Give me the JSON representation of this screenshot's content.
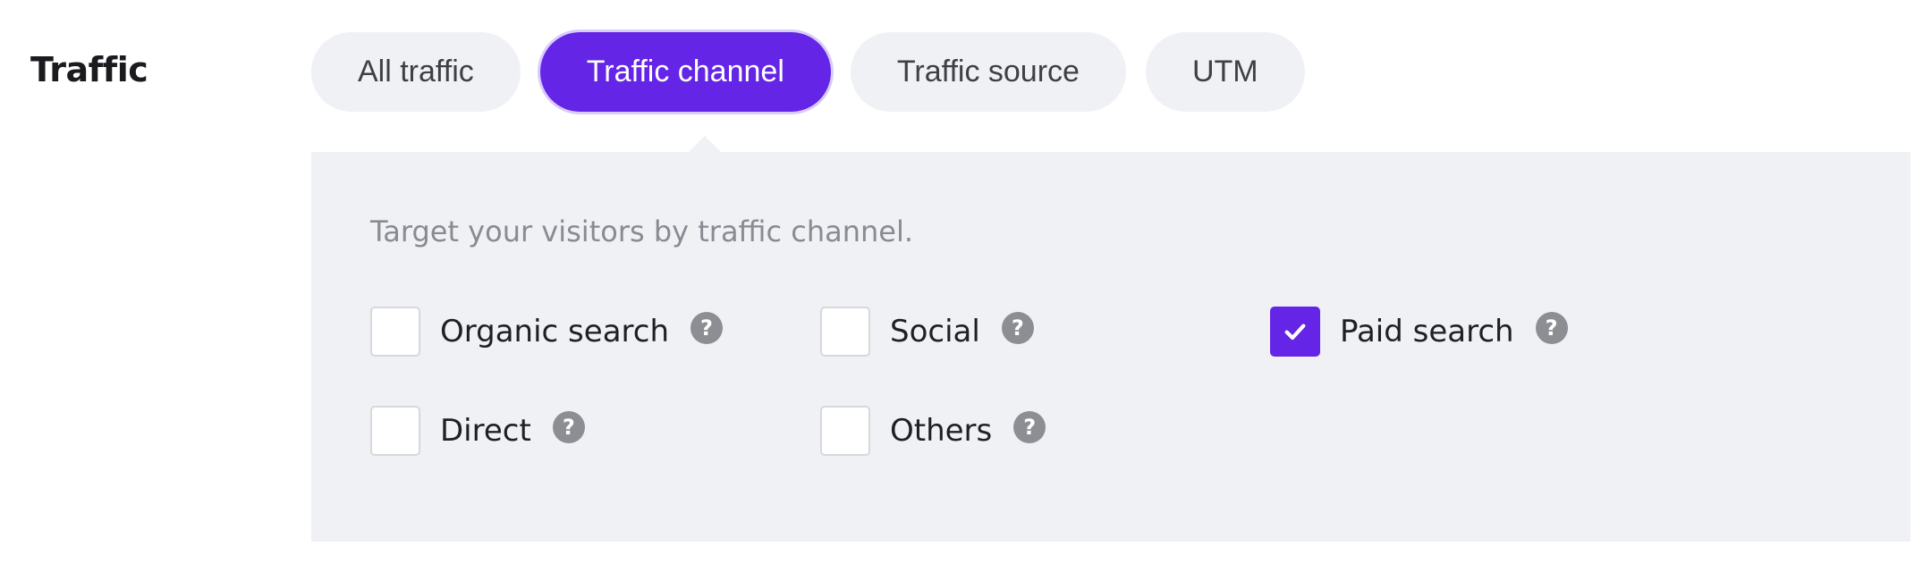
{
  "section": {
    "title": "Traffic"
  },
  "tabs": [
    {
      "label": "All traffic",
      "active": false
    },
    {
      "label": "Traffic channel",
      "active": true
    },
    {
      "label": "Traffic source",
      "active": false
    },
    {
      "label": "UTM",
      "active": false
    }
  ],
  "panel": {
    "description": "Target your visitors by traffic channel.",
    "options": [
      {
        "label": "Organic search",
        "checked": false,
        "help_icon": "question-mark-icon"
      },
      {
        "label": "Social",
        "checked": false,
        "help_icon": "question-mark-icon"
      },
      {
        "label": "Paid search",
        "checked": true,
        "help_icon": "question-mark-icon"
      },
      {
        "label": "Direct",
        "checked": false,
        "help_icon": "question-mark-icon"
      },
      {
        "label": "Others",
        "checked": false,
        "help_icon": "question-mark-icon"
      }
    ],
    "help_glyph": "?"
  },
  "colors": {
    "accent": "#6425e6",
    "panel_bg": "#eff1f4",
    "help_icon_bg": "#8d8d94"
  }
}
